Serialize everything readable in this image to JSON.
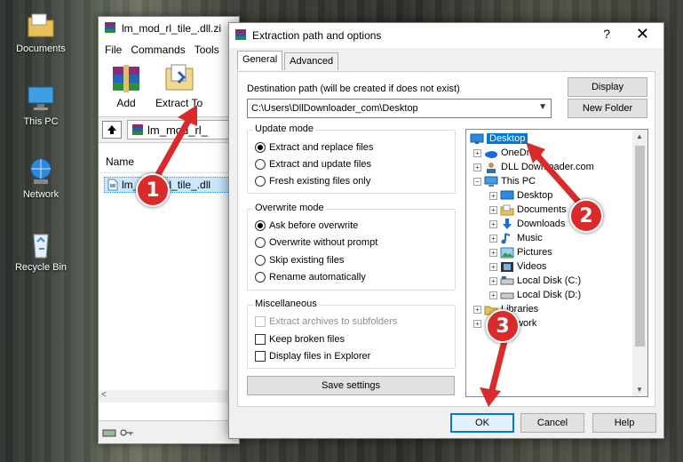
{
  "desktop": {
    "icons": [
      {
        "label": "Documents"
      },
      {
        "label": "This PC"
      },
      {
        "label": "Network"
      },
      {
        "label": "Recycle Bin"
      }
    ]
  },
  "winrar": {
    "title": "lm_mod_rl_tile_.dll.zi",
    "menu": [
      "File",
      "Commands",
      "Tools"
    ],
    "toolbar": {
      "add": "Add",
      "extract": "Extract To"
    },
    "path": "lm_mod_rl_",
    "column_name": "Name",
    "file_row": "lm_mod_rl_tile_.dll",
    "scroll_left": "<"
  },
  "dialog": {
    "title": "Extraction path and options",
    "help": "?",
    "close": "✕",
    "tabs": [
      "General",
      "Advanced"
    ],
    "dest_label": "Destination path (will be created if does not exist)",
    "dest_value": "C:\\Users\\DllDownloader_com\\Desktop",
    "display_btn": "Display",
    "new_folder_btn": "New Folder",
    "update_mode": {
      "label": "Update mode",
      "options": [
        "Extract and replace files",
        "Extract and update files",
        "Fresh existing files only"
      ],
      "selected": 0
    },
    "overwrite_mode": {
      "label": "Overwrite mode",
      "options": [
        "Ask before overwrite",
        "Overwrite without prompt",
        "Skip existing files",
        "Rename automatically"
      ],
      "selected": 0
    },
    "misc": {
      "label": "Miscellaneous",
      "options": [
        "Extract archives to subfolders",
        "Keep broken files",
        "Display files in Explorer"
      ]
    },
    "save_settings": "Save settings",
    "tree": {
      "items": [
        "Desktop",
        "OneDrive",
        "DLL Downloader.com",
        "This PC",
        "Desktop",
        "Documents",
        "Downloads",
        "Music",
        "Pictures",
        "Videos",
        "Local Disk (C:)",
        "Local Disk (D:)",
        "Libraries",
        "Network"
      ]
    },
    "ok": "OK",
    "cancel": "Cancel",
    "help_btn": "Help"
  },
  "annotations": {
    "steps": [
      "1",
      "2",
      "3"
    ],
    "arrow_color": "#d92b2b"
  },
  "colors": {
    "accent": "#0078d7",
    "callout": "#d92b2b"
  }
}
